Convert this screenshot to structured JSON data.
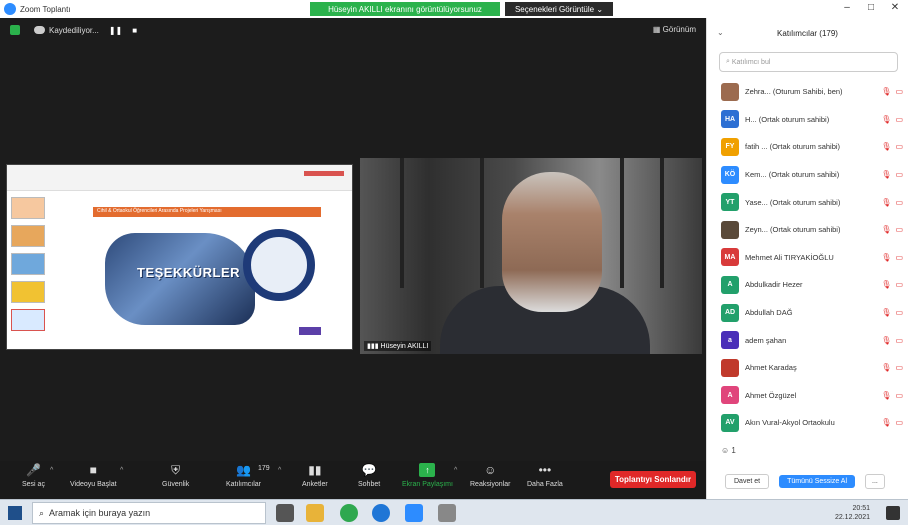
{
  "window": {
    "title": "Zoom Toplantı",
    "share_banner": "Hüseyin AKILLI ekranını görüntülüyorsunuz",
    "view_options": "Seçenekleri Görüntüle ⌄"
  },
  "meeting_top": {
    "recording_label": "Kaydediliyor...",
    "view_label": "Görünüm"
  },
  "shared_slide": {
    "stage_title": "Cihil & Ortaokul Öğrencileri Arasında Projeleri Yarışması",
    "big_text": "TEŞEKKÜRLER"
  },
  "camera": {
    "name_label": "Hüseyin AKILLI"
  },
  "toolbar": {
    "audio": "Sesi aç",
    "video": "Videoyu Başlat",
    "security": "Güvenlik",
    "participants": "Katılımcılar",
    "participants_count": "179",
    "polls": "Anketler",
    "chat": "Sohbet",
    "share": "Ekran Paylaşımı",
    "reactions": "Reaksiyonlar",
    "more": "Daha Fazla",
    "end": "Toplantıyı Sonlandır"
  },
  "panel": {
    "title": "Katılımcılar (179)",
    "search_placeholder": "Katılımcı bul",
    "participants": [
      {
        "initials": "",
        "color": "#9c6b4f",
        "name": "Zehra... (Oturum Sahibi, ben)"
      },
      {
        "initials": "HA",
        "color": "#2d6fd3",
        "name": "H... (Ortak oturum sahibi)"
      },
      {
        "initials": "FY",
        "color": "#f0a000",
        "name": "fatih ... (Ortak oturum sahibi)"
      },
      {
        "initials": "KÖ",
        "color": "#2d8cff",
        "name": "Kem... (Ortak oturum sahibi)"
      },
      {
        "initials": "YT",
        "color": "#22a06b",
        "name": "Yase... (Ortak oturum sahibi)"
      },
      {
        "initials": "",
        "color": "#5a4a3a",
        "name": "Zeyn... (Ortak oturum sahibi)"
      },
      {
        "initials": "MA",
        "color": "#d83a3a",
        "name": "Mehmet Ali TIRYAKİOĞLU"
      },
      {
        "initials": "A",
        "color": "#22a06b",
        "name": "Abdulkadir Hezer"
      },
      {
        "initials": "AD",
        "color": "#22a06b",
        "name": "Abdullah DAĞ"
      },
      {
        "initials": "a",
        "color": "#4a2fb8",
        "name": "adem şahan"
      },
      {
        "initials": "",
        "color": "#c0392b",
        "name": "Ahmet Karadaş"
      },
      {
        "initials": "A",
        "color": "#e0457b",
        "name": "Ahmet Özgüzel"
      },
      {
        "initials": "AV",
        "color": "#22a06b",
        "name": "Akın Vural-Akyol Ortaokulu"
      }
    ],
    "raised_count": "1",
    "invite": "Davet et",
    "mute_all": "Tümünü Sessize Al",
    "more": "..."
  },
  "taskbar": {
    "search_placeholder": "Aramak için buraya yazın",
    "time": "20:51",
    "date": "22.12.2021"
  }
}
